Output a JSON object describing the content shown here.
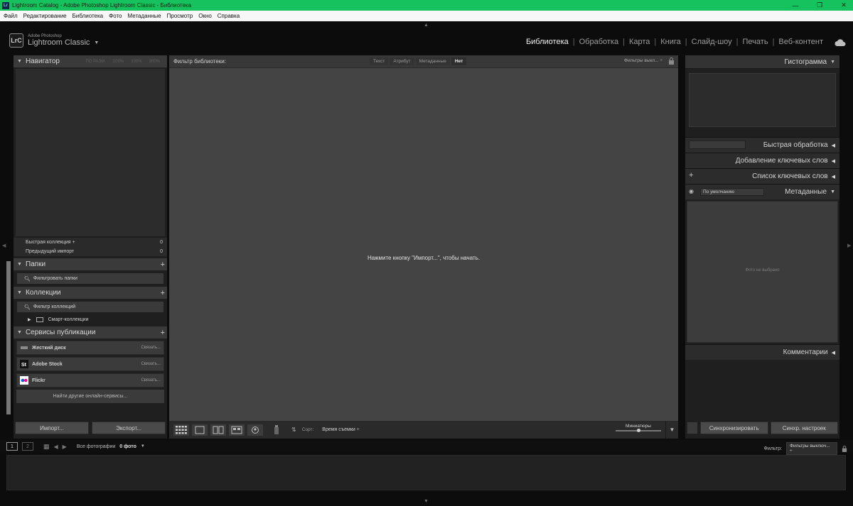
{
  "window": {
    "title": "Lightroom Catalog - Adobe Photoshop Lightroom Classic - Библиотека",
    "app_icon_text": "Lr"
  },
  "menu": [
    "Файл",
    "Редактирование",
    "Библиотека",
    "Фото",
    "Метаданные",
    "Просмотр",
    "Окно",
    "Справка"
  ],
  "identity": {
    "badge": "LrC",
    "company": "Adobe Photoshop",
    "product": "Lightroom Classic",
    "caret": "▼"
  },
  "modules": {
    "items": [
      "Библиотека",
      "Обработка",
      "Карта",
      "Книга",
      "Слайд-шоу",
      "Печать",
      "Веб-контент"
    ],
    "active": "Библиотека"
  },
  "left_panel": {
    "navigator": {
      "title": "Навигатор",
      "zoom": [
        "ПО РАЗМ.",
        "100%",
        "100%",
        "300%"
      ]
    },
    "catalog_rows": [
      {
        "label": "Быстрая коллекция +",
        "count": "0"
      },
      {
        "label": "Предыдущий импорт",
        "count": "0"
      }
    ],
    "folders": {
      "title": "Папки",
      "filter_placeholder": "Фильтровать папки"
    },
    "collections": {
      "title": "Коллекции",
      "filter_placeholder": "Фильтр коллекций",
      "smart": "Смарт-коллекции"
    },
    "publish": {
      "title": "Сервисы публикации",
      "services": [
        {
          "name": "Жесткий диск",
          "link": "Связать..."
        },
        {
          "name": "Adobe Stock",
          "link": "Связать..."
        },
        {
          "name": "Flickr",
          "link": "Связать..."
        }
      ],
      "more": "Найти другие онлайн-сервисы..."
    },
    "import_label": "Импорт...",
    "export_label": "Экспорт..."
  },
  "center": {
    "filter_label": "Фильтр библиотеки:",
    "filter_tabs": [
      "Текст",
      "Атрибут",
      "Метаданные",
      "Нет"
    ],
    "active_tab": "Нет",
    "filter_off": "Фильтры выкл... ÷",
    "message": "Нажмите кнопку \"Импорт...\", чтобы начать.",
    "sort_label": "Сорт:",
    "sort_value": "Время съемки ÷",
    "thumbs_label": "Миниатюры"
  },
  "right_panel": {
    "histogram": "Гистограмма",
    "quick_develop": "Быстрая обработка",
    "add_keywords": "Добавление ключевых слов",
    "keyword_list": "Список ключевых слов",
    "metadata": "Метаданные",
    "metadata_preset": "По умолчанию",
    "no_photo": "Фото не выбрано",
    "comments": "Комментарии",
    "sync_label": "Синхронизировать",
    "sync_settings_label": "Синхр. настроек"
  },
  "filmstrip": {
    "mon1": "1",
    "mon2": "2",
    "source": "Все фотографии",
    "count": "0 фото",
    "filter_label": "Фильтр:",
    "filter_value": "Фильтры выключ... ÷"
  },
  "colors": {
    "titlebar": "#16c25e",
    "panel": "#1f1f1f",
    "center": "#444444"
  }
}
